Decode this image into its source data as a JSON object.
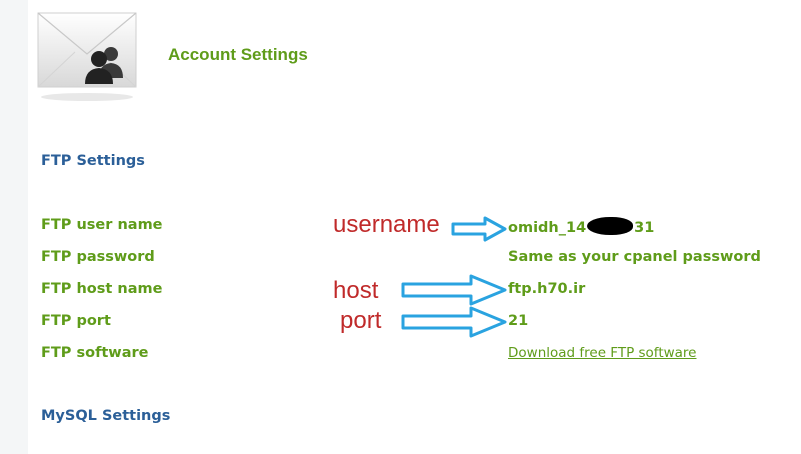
{
  "header": {
    "title": "Account Settings",
    "icon": "account-users-icon"
  },
  "sections": {
    "ftp_heading": "FTP Settings",
    "mysql_heading": "MySQL Settings"
  },
  "ftp": {
    "user_name_label": "FTP user name",
    "user_name_value_prefix": "omidh_14",
    "user_name_value_suffix": "31",
    "password_label": "FTP password",
    "password_value": "Same as your cpanel password",
    "host_label": "FTP host name",
    "host_value": "ftp.h70.ir",
    "port_label": "FTP port",
    "port_value": "21",
    "software_label": "FTP software",
    "software_link": "Download free FTP software"
  },
  "annotations": {
    "username": "username",
    "host": "host",
    "port": "port",
    "annotation_color": "#c02a2a",
    "arrow_color": "#2aa3e0",
    "arrow_icon": "right-arrow-icon"
  },
  "colors": {
    "label_green": "#5f9c1a",
    "heading_blue": "#2b5f98",
    "redaction": "#000000"
  }
}
